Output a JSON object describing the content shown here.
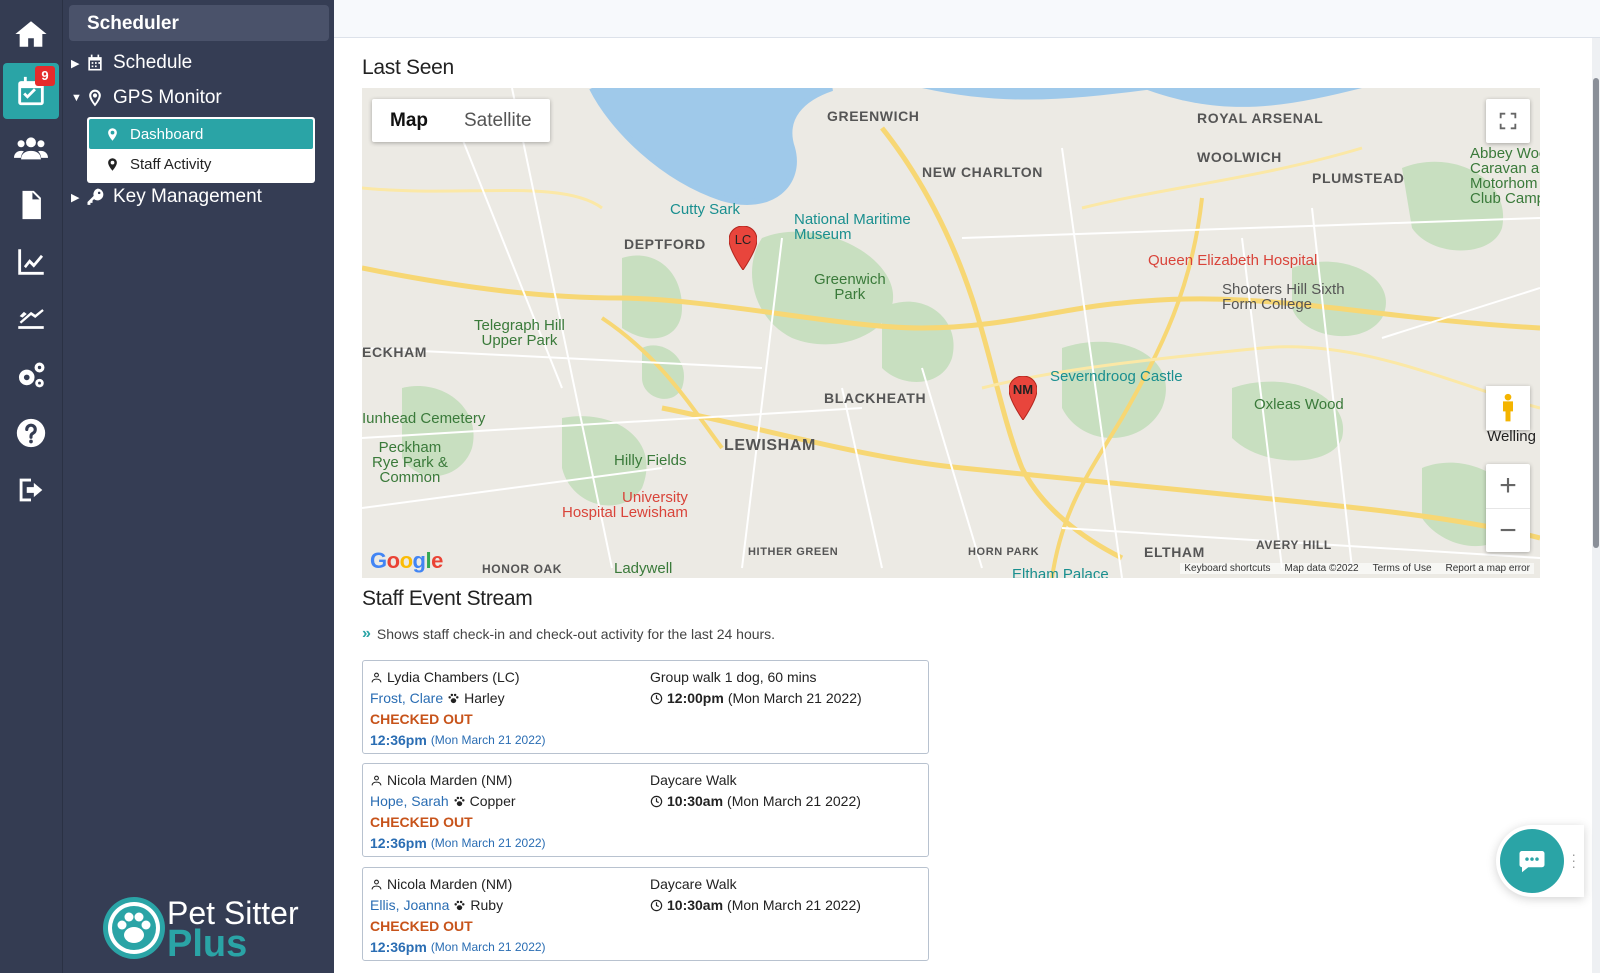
{
  "rail": {
    "items": [
      {
        "name": "home-icon"
      },
      {
        "name": "scheduler-icon",
        "badge": "9"
      },
      {
        "name": "clients-icon"
      },
      {
        "name": "documents-icon"
      },
      {
        "name": "reports-icon"
      },
      {
        "name": "payroll-icon"
      },
      {
        "name": "settings-icon"
      },
      {
        "name": "help-icon"
      },
      {
        "name": "logout-icon"
      }
    ],
    "accent": "#2aa4a6"
  },
  "sidebar": {
    "title": "Scheduler",
    "items": [
      {
        "label": "Schedule",
        "icon": "calendar-icon"
      },
      {
        "label": "GPS Monitor",
        "icon": "map-pin-icon"
      },
      {
        "label": "Key Management",
        "icon": "key-icon"
      }
    ],
    "gps_submenu": [
      {
        "label": "Dashboard",
        "active": true
      },
      {
        "label": "Staff Activity",
        "active": false
      }
    ],
    "logo": {
      "line1": "Pet Sitter",
      "line2": "Plus"
    }
  },
  "main": {
    "last_seen_title": "Last Seen",
    "map": {
      "tabs": [
        "Map",
        "Satellite"
      ],
      "selected_tab": "Map",
      "pegman_label": "Welling",
      "zoom_in": "+",
      "zoom_out": "−",
      "google": "Google",
      "attribution": [
        "Keyboard shortcuts",
        "Map data ©2022",
        "Terms of Use",
        "Report a map error"
      ],
      "markers": [
        {
          "label": "LC"
        },
        {
          "label": "NM"
        }
      ],
      "labels": {
        "greenwich": "GREENWICH",
        "royal_arsenal": "ROYAL ARSENAL",
        "new_charlton": "NEW CHARLTON",
        "woolwich": "WOOLWICH",
        "plumstead": "PLUMSTEAD",
        "deptford": "DEPTFORD",
        "cutty_sark": "Cutty Sark",
        "nmm": "National Maritime\nMuseum",
        "greenwich_park": "Greenwich\nPark",
        "qeh": "Queen Elizabeth Hospital",
        "shooters": "Shooters Hill Sixth\nForm College",
        "telegraph": "Telegraph Hill\nUpper Park",
        "peckham": "ECKHAM",
        "blackheath": "BLACKHEATH",
        "severndroog": "Severndroog Castle",
        "oxleas": "Oxleas Wood",
        "lewisham": "LEWISHAM",
        "nunhead": "Iunhead Cemetery",
        "peckham_rye": "Peckham\nRye Park &\nCommon",
        "hilly_fields": "Hilly Fields",
        "uhl": "University\nHospital Lewisham",
        "ladywell": "Ladywell",
        "honor_oak": "HONOR OAK",
        "hither_green": "HITHER GREEN",
        "horn_park": "HORN PARK",
        "eltham": "ELTHAM",
        "avery_hill": "AVERY HILL",
        "eltham_palace": "Eltham Palace",
        "abbey_wood": "Abbey Woo\nCaravan a\nMotorhom\nClub Camps"
      }
    },
    "stream_title": "Staff Event Stream",
    "stream_hint": "Shows staff check-in and check-out activity for the last 24 hours.",
    "events": [
      {
        "staff": "Lydia Chambers (LC)",
        "client": "Frost, Clare",
        "pet": "Harley",
        "status": "CHECKED OUT",
        "time": "12:36pm",
        "date": "(Mon March 21 2022)",
        "service": "Group walk 1 dog, 60 mins",
        "sched_time": "12:00pm",
        "sched_date": "(Mon March 21 2022)"
      },
      {
        "staff": "Nicola Marden (NM)",
        "client": "Hope, Sarah",
        "pet": "Copper",
        "status": "CHECKED OUT",
        "time": "12:36pm",
        "date": "(Mon March 21 2022)",
        "service": "Daycare Walk",
        "sched_time": "10:30am",
        "sched_date": "(Mon March 21 2022)"
      },
      {
        "staff": "Nicola Marden (NM)",
        "client": "Ellis, Joanna",
        "pet": "Ruby",
        "status": "CHECKED OUT",
        "time": "12:36pm",
        "date": "(Mon March 21 2022)",
        "service": "Daycare Walk",
        "sched_time": "10:30am",
        "sched_date": "(Mon March 21 2022)"
      }
    ]
  }
}
